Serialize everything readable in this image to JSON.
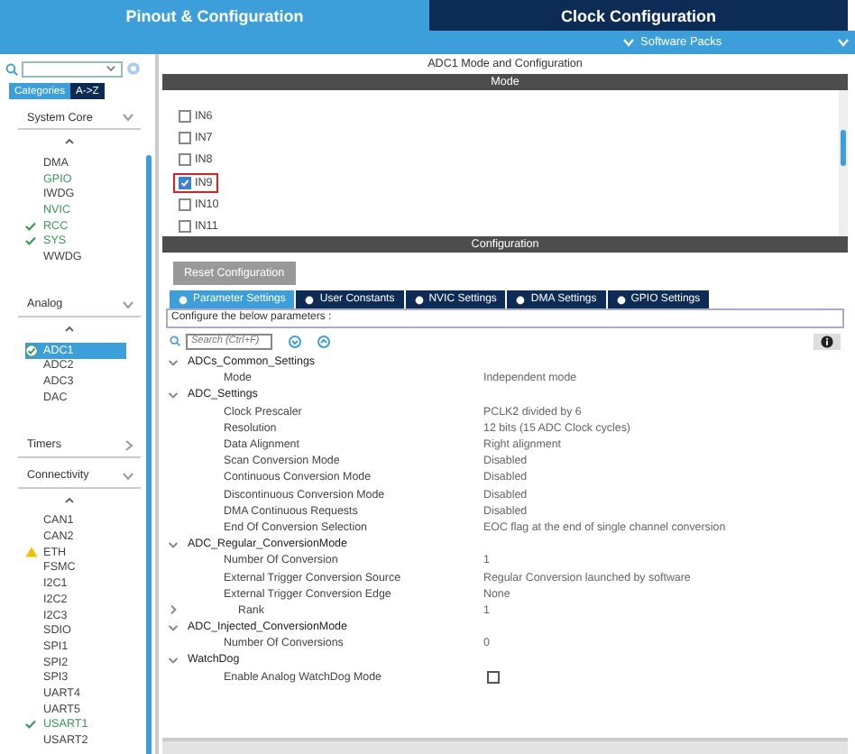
{
  "top_tabs": [
    {
      "label": "Pinout & Configuration",
      "selected": true
    },
    {
      "label": "Clock Configuration",
      "selected": false
    }
  ],
  "software_packs": {
    "label": "Software Packs"
  },
  "sidebar": {
    "tabs": [
      {
        "label": "Categories",
        "selected": true
      },
      {
        "label": "A->Z",
        "selected": false
      }
    ],
    "groups": [
      {
        "label": "System Core",
        "expanded": true,
        "items": [
          {
            "label": "DMA",
            "configured": false,
            "checked": false,
            "warning": false,
            "selected": false
          },
          {
            "label": "GPIO",
            "configured": true,
            "checked": false,
            "warning": false,
            "selected": false
          },
          {
            "label": "IWDG",
            "configured": false,
            "checked": false,
            "warning": false,
            "selected": false
          },
          {
            "label": "NVIC",
            "configured": true,
            "checked": false,
            "warning": false,
            "selected": false
          },
          {
            "label": "RCC",
            "configured": true,
            "checked": true,
            "warning": false,
            "selected": false
          },
          {
            "label": "SYS",
            "configured": true,
            "checked": true,
            "warning": false,
            "selected": false
          },
          {
            "label": "WWDG",
            "configured": false,
            "checked": false,
            "warning": false,
            "selected": false
          }
        ]
      },
      {
        "label": "Analog",
        "expanded": true,
        "items": [
          {
            "label": "ADC1",
            "configured": true,
            "checked": true,
            "warning": false,
            "selected": true
          },
          {
            "label": "ADC2",
            "configured": false,
            "checked": false,
            "warning": false,
            "selected": false
          },
          {
            "label": "ADC3",
            "configured": false,
            "checked": false,
            "warning": false,
            "selected": false
          },
          {
            "label": "DAC",
            "configured": false,
            "checked": false,
            "warning": false,
            "selected": false
          }
        ]
      },
      {
        "label": "Timers",
        "expanded": false
      },
      {
        "label": "Connectivity",
        "expanded": true,
        "items": [
          {
            "label": "CAN1",
            "configured": false,
            "checked": false,
            "warning": false,
            "selected": false
          },
          {
            "label": "CAN2",
            "configured": false,
            "checked": false,
            "warning": false,
            "selected": false
          },
          {
            "label": "ETH",
            "configured": false,
            "checked": false,
            "warning": true,
            "selected": false
          },
          {
            "label": "FSMC",
            "configured": false,
            "checked": false,
            "warning": false,
            "selected": false
          },
          {
            "label": "I2C1",
            "configured": false,
            "checked": false,
            "warning": false,
            "selected": false
          },
          {
            "label": "I2C2",
            "configured": false,
            "checked": false,
            "warning": false,
            "selected": false
          },
          {
            "label": "I2C3",
            "configured": false,
            "checked": false,
            "warning": false,
            "selected": false
          },
          {
            "label": "SDIO",
            "configured": false,
            "checked": false,
            "warning": false,
            "selected": false
          },
          {
            "label": "SPI1",
            "configured": false,
            "checked": false,
            "warning": false,
            "selected": false
          },
          {
            "label": "SPI2",
            "configured": false,
            "checked": false,
            "warning": false,
            "selected": false
          },
          {
            "label": "SPI3",
            "configured": false,
            "checked": false,
            "warning": false,
            "selected": false
          },
          {
            "label": "UART4",
            "configured": false,
            "checked": false,
            "warning": false,
            "selected": false
          },
          {
            "label": "UART5",
            "configured": false,
            "checked": false,
            "warning": false,
            "selected": false
          },
          {
            "label": "USART1",
            "configured": true,
            "checked": true,
            "warning": false,
            "selected": false
          },
          {
            "label": "USART2",
            "configured": false,
            "checked": false,
            "warning": false,
            "selected": false
          }
        ]
      }
    ]
  },
  "panel": {
    "title": "ADC1 Mode and Configuration",
    "mode_header": "Mode",
    "channels": [
      {
        "label": "IN6",
        "checked": false,
        "highlighted": false
      },
      {
        "label": "IN7",
        "checked": false,
        "highlighted": false
      },
      {
        "label": "IN8",
        "checked": false,
        "highlighted": false
      },
      {
        "label": "IN9",
        "checked": true,
        "highlighted": true
      },
      {
        "label": "IN10",
        "checked": false,
        "highlighted": false
      },
      {
        "label": "IN11",
        "checked": false,
        "highlighted": false
      }
    ],
    "config_header": "Configuration",
    "reset_button": {
      "label": "Reset Configuration",
      "disabled": true
    },
    "tabs": [
      {
        "label": "Parameter Settings",
        "selected": true
      },
      {
        "label": "User Constants",
        "selected": false
      },
      {
        "label": "NVIC Settings",
        "selected": false
      },
      {
        "label": "DMA Settings",
        "selected": false
      },
      {
        "label": "GPIO Settings",
        "selected": false
      }
    ],
    "hint": "Configure the below parameters :",
    "search": {
      "placeholder": "Search (Ctrl+F)"
    },
    "parameters": [
      {
        "label": "ADCs_Common_Settings",
        "expanded": true,
        "children": [
          {
            "kind": "text",
            "label": "Mode",
            "value": "Independent mode"
          }
        ]
      },
      {
        "label": "ADC_Settings",
        "expanded": true,
        "children": [
          {
            "kind": "text",
            "label": "Clock Prescaler",
            "value": "PCLK2 divided by 6"
          },
          {
            "kind": "text",
            "label": "Resolution",
            "value": "12 bits (15 ADC Clock cycles)"
          },
          {
            "kind": "text",
            "label": "Data Alignment",
            "value": "Right alignment"
          },
          {
            "kind": "text",
            "label": "Scan Conversion Mode",
            "value": "Disabled"
          },
          {
            "kind": "text",
            "label": "Continuous Conversion Mode",
            "value": "Disabled"
          },
          {
            "kind": "text",
            "label": "Discontinuous Conversion Mode",
            "value": "Disabled"
          },
          {
            "kind": "text",
            "label": "DMA Continuous Requests",
            "value": "Disabled"
          },
          {
            "kind": "text",
            "label": "End Of Conversion Selection",
            "value": "EOC flag at the end of single channel conversion"
          }
        ]
      },
      {
        "label": "ADC_Regular_ConversionMode",
        "expanded": true,
        "children": [
          {
            "kind": "text",
            "label": "Number Of Conversion",
            "value": "1"
          },
          {
            "kind": "text",
            "label": "External Trigger Conversion Source",
            "value": "Regular Conversion launched by software"
          },
          {
            "kind": "text",
            "label": "External Trigger Conversion Edge",
            "value": "None"
          },
          {
            "kind": "subgroup",
            "label": "Rank",
            "value": "1",
            "expanded": false
          }
        ]
      },
      {
        "label": "ADC_Injected_ConversionMode",
        "expanded": true,
        "children": [
          {
            "kind": "text",
            "label": "Number Of Conversions",
            "value": "0"
          }
        ]
      },
      {
        "label": "WatchDog",
        "expanded": true,
        "children": [
          {
            "kind": "checkbox",
            "label": "Enable Analog WatchDog Mode",
            "checked": false
          }
        ]
      }
    ]
  }
}
